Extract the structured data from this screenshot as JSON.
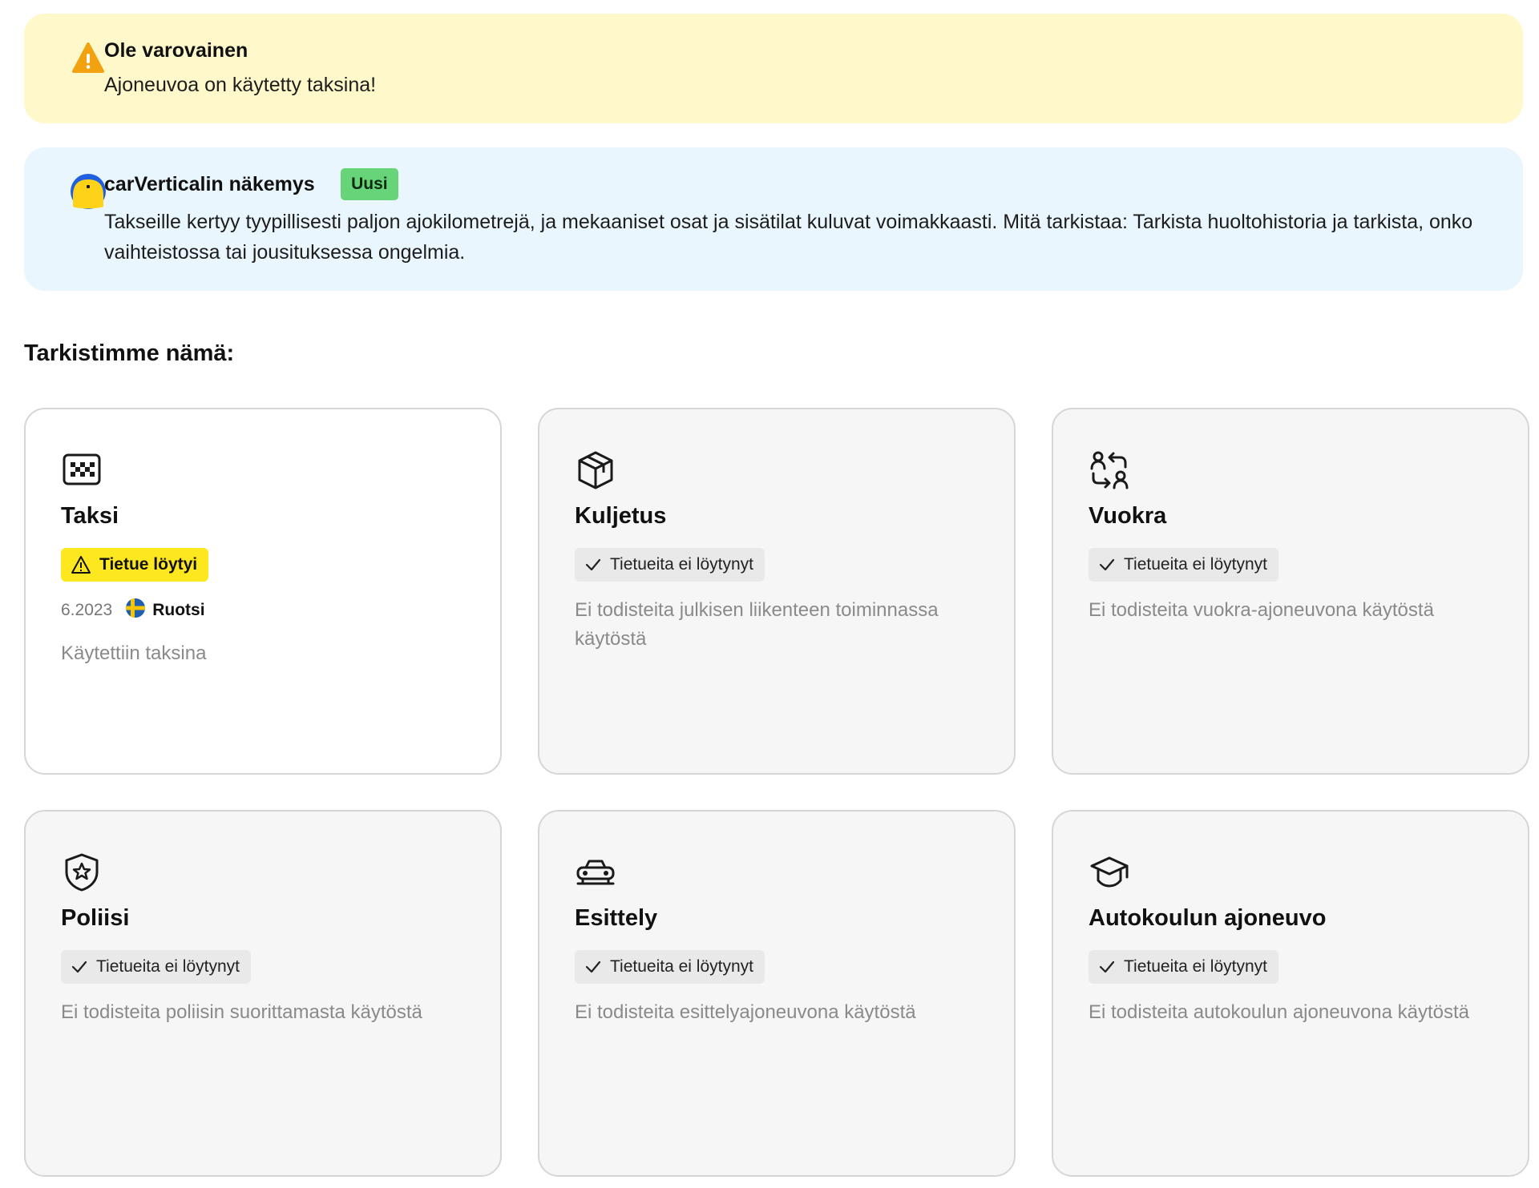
{
  "warning": {
    "title": "Ole varovainen",
    "text": "Ajoneuvoa on käytetty taksina!",
    "icon": "warning-triangle-icon",
    "color": "#fef8cb"
  },
  "insight": {
    "title": "carVerticalin näkemys",
    "badge": "Uusi",
    "text": "Takseille kertyy tyypillisesti paljon ajokilometrejä, ja mekaaniset osat ja sisätilat kuluvat voimakkaasti. Mitä tarkistaa: Tarkista huoltohistoria ja tarkista, onko vaihteistossa tai jousituksessa ongelmia.",
    "icon": "carvertical-avatar-icon",
    "color": "#eaf6fd"
  },
  "section_title": "Tarkistimme nämä:",
  "cards": [
    {
      "title": "Taksi",
      "icon": "taxi-icon",
      "status": "Tietue löytyi",
      "status_type": "found",
      "record": {
        "date": "6.2023",
        "country": "Ruotsi",
        "flag": "sweden-flag-icon"
      },
      "description": "Käytettiin taksina"
    },
    {
      "title": "Kuljetus",
      "icon": "package-icon",
      "status": "Tietueita ei löytynyt",
      "status_type": "ok",
      "description": "Ei todisteita julkisen liikenteen toiminnassa käytöstä"
    },
    {
      "title": "Vuokra",
      "icon": "user-swap-icon",
      "status": "Tietueita ei löytynyt",
      "status_type": "ok",
      "description": "Ei todisteita vuokra-ajoneuvona käytöstä"
    },
    {
      "title": "Poliisi",
      "icon": "police-badge-icon",
      "status": "Tietueita ei löytynyt",
      "status_type": "ok",
      "description": "Ei todisteita poliisin suorittamasta käytöstä"
    },
    {
      "title": "Esittely",
      "icon": "demo-car-icon",
      "status": "Tietueita ei löytynyt",
      "status_type": "ok",
      "description": "Ei todisteita esittelyajoneuvona käytöstä"
    },
    {
      "title": "Autokoulun ajoneuvo",
      "icon": "graduation-cap-icon",
      "status": "Tietueita ei löytynyt",
      "status_type": "ok",
      "description": "Ei todisteita autokoulun ajoneuvona käytöstä"
    }
  ]
}
